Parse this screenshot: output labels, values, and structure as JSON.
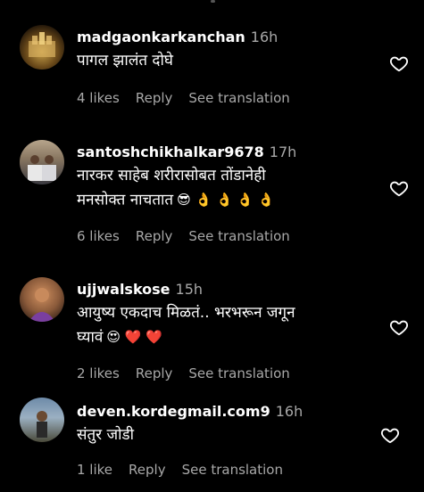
{
  "comments": [
    {
      "username": "madgaonkarkanchan",
      "time": "16h",
      "lines": [
        "पागल झालंत दोघे"
      ],
      "emojis": "",
      "likes": "4 likes",
      "reply": "Reply",
      "translate": "See translation"
    },
    {
      "username": "santoshchikhalkar9678",
      "time": "17h",
      "lines": [
        "नारकर साहेब शरीरासोबत तोंडानेही",
        "मनसोक्त नाचतात"
      ],
      "emojis": "😎 👌 👌 👌 👌",
      "likes": "6 likes",
      "reply": "Reply",
      "translate": "See translation"
    },
    {
      "username": "ujjwalskose",
      "time": "15h",
      "lines": [
        "आयुष्य एकदाच मिळतं.. भरभरून जगून",
        "घ्यावं"
      ],
      "emojis": "😍 ❤️ ❤️",
      "likes": "2 likes",
      "reply": "Reply",
      "translate": "See translation"
    },
    {
      "username": "deven.kordegmail.com9",
      "time": "16h",
      "lines": [
        "संतुर जोडी"
      ],
      "emojis": "",
      "likes": "1 like",
      "reply": "Reply",
      "translate": "See translation"
    }
  ],
  "colors": {
    "background": "#000000",
    "secondary_text": "#a8a8a8",
    "heart_outline": "#ffffff"
  }
}
